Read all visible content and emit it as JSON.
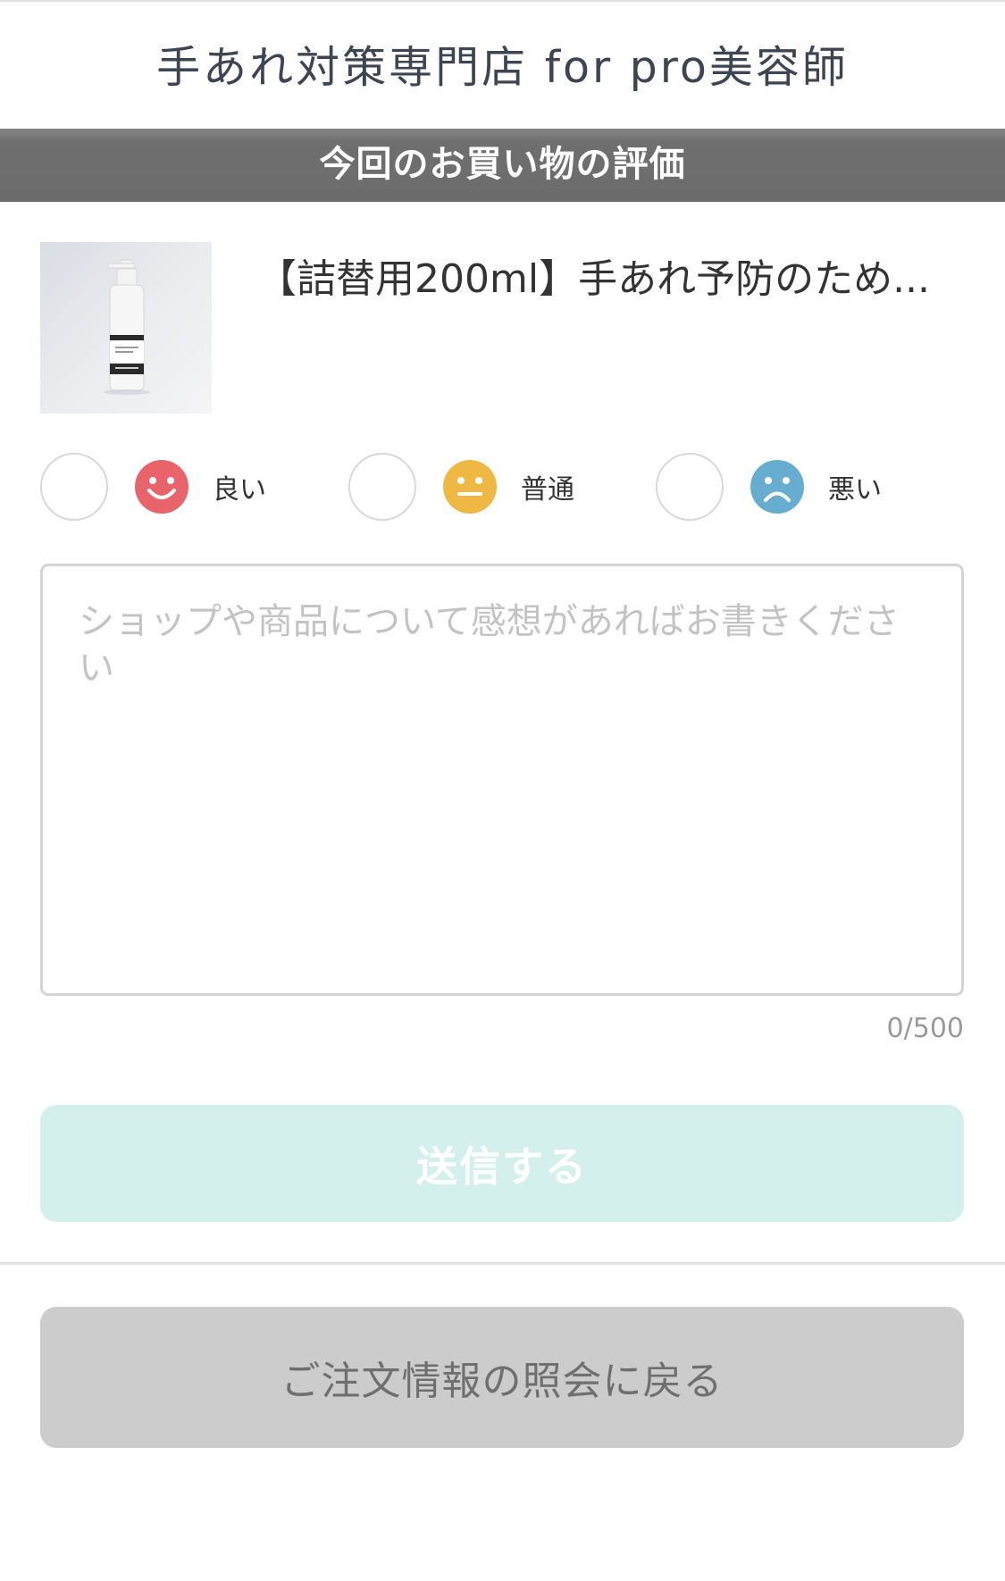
{
  "header": {
    "shop_name": "手あれ対策専門店 for pro美容師"
  },
  "section": {
    "title": "今回のお買い物の評価"
  },
  "product": {
    "name": "【詰替用200ml】手あれ予防のため..."
  },
  "rating": {
    "selected": null,
    "options": [
      {
        "label": "良い",
        "icon": "smile-face-icon",
        "color": "#e8636a"
      },
      {
        "label": "普通",
        "icon": "neutral-face-icon",
        "color": "#efb842"
      },
      {
        "label": "悪い",
        "icon": "sad-face-icon",
        "color": "#66adcf"
      }
    ]
  },
  "comment": {
    "value": "",
    "placeholder": "ショップや商品について感想があればお書きください",
    "counter": "0/500"
  },
  "buttons": {
    "submit_label": "送信する",
    "back_label": "ご注文情報の照会に戻る"
  },
  "colors": {
    "submit_bg": "#d3f0ec",
    "back_bg": "#cccccc",
    "section_bar_bg": "#6c6c6c"
  }
}
